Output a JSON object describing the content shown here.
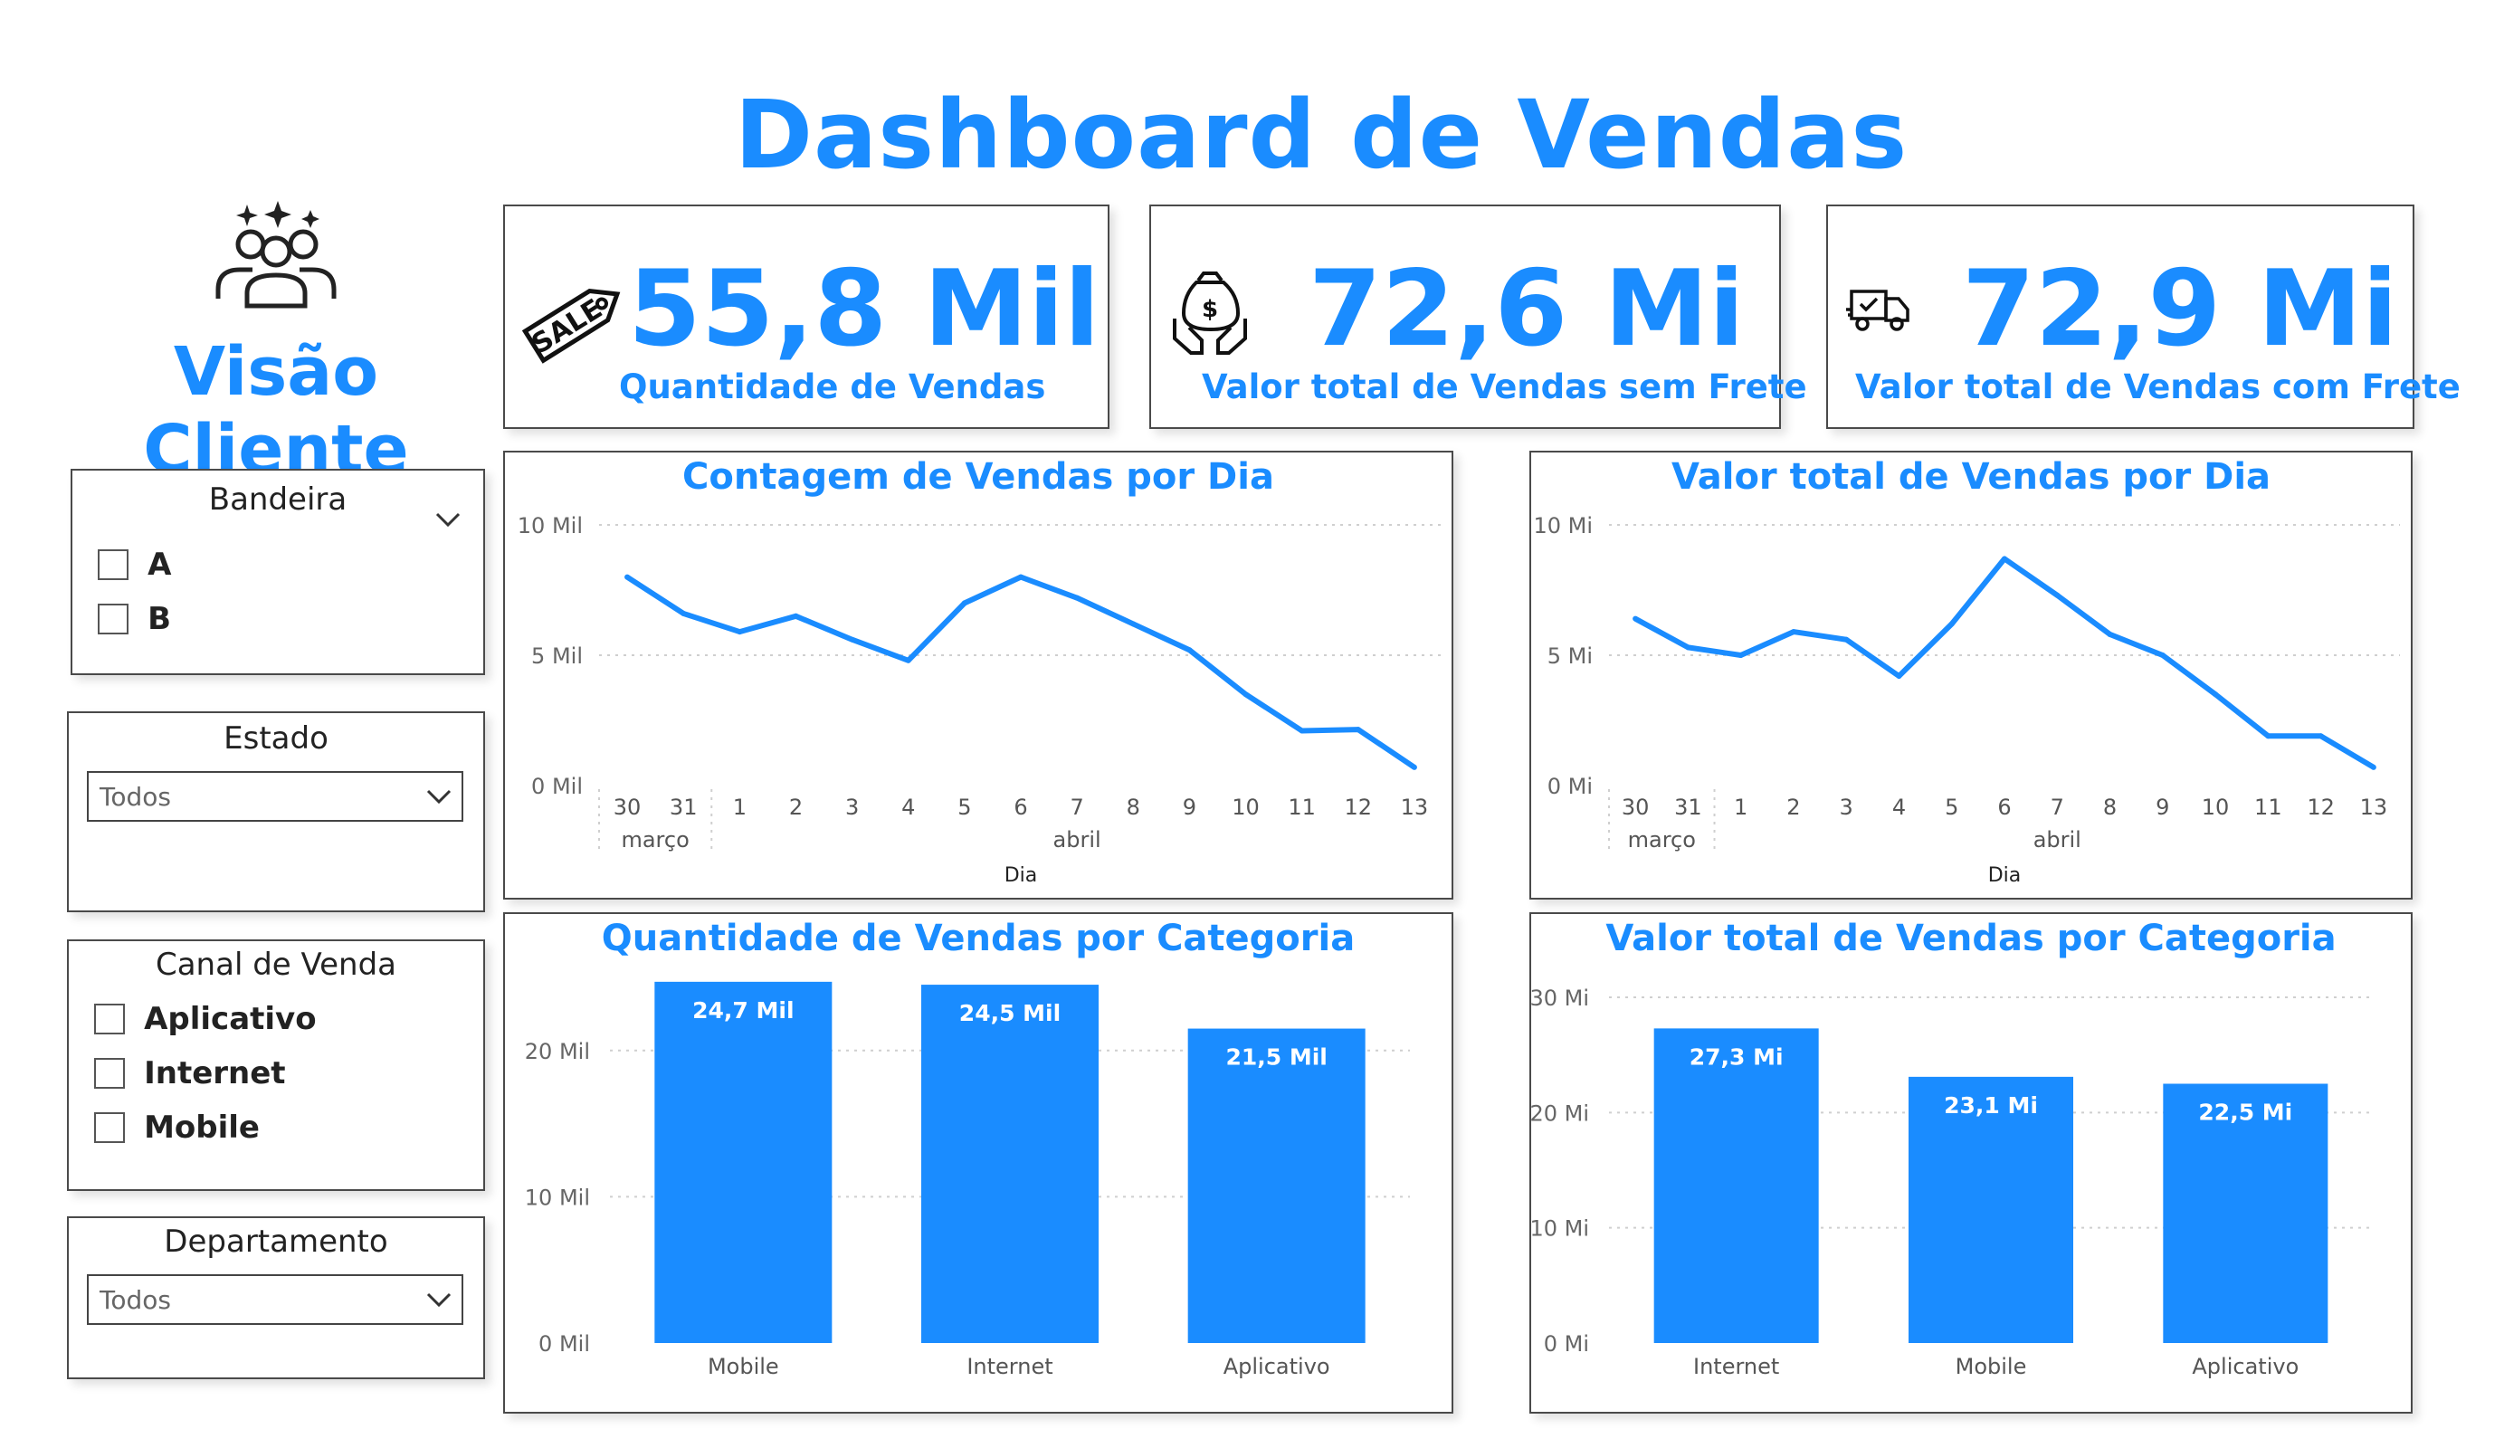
{
  "dashboard_title": "Dashboard de Vendas",
  "sidebar": {
    "heading": "Visão Cliente",
    "bandeira": {
      "title": "Bandeira",
      "options": [
        "A",
        "B"
      ]
    },
    "estado": {
      "title": "Estado",
      "selected": "Todos"
    },
    "canal": {
      "title": "Canal de Venda",
      "options": [
        "Aplicativo",
        "Internet",
        "Mobile"
      ]
    },
    "departamento": {
      "title": "Departamento",
      "selected": "Todos"
    }
  },
  "kpis": [
    {
      "value": "55,8 Mil",
      "label": "Quantidade de Vendas",
      "icon": "sale-tag-icon"
    },
    {
      "value": "72,6 Mi",
      "label": "Valor total de Vendas sem Frete",
      "icon": "money-hands-icon"
    },
    {
      "value": "72,9 Mi",
      "label": "Valor total de Vendas com Frete",
      "icon": "delivery-truck-icon"
    }
  ],
  "accent_color": "#1a8cff",
  "chart_data": [
    {
      "type": "line",
      "title": "Contagem de Vendas por Dia",
      "xlabel": "Dia",
      "x": [
        "30",
        "31",
        "1",
        "2",
        "3",
        "4",
        "5",
        "6",
        "7",
        "8",
        "9",
        "10",
        "11",
        "12",
        "13"
      ],
      "month_groups": [
        {
          "label": "março",
          "from": 0,
          "to": 1
        },
        {
          "label": "abril",
          "from": 2,
          "to": 14
        }
      ],
      "values": [
        8000,
        6600,
        5900,
        6500,
        5600,
        4800,
        7000,
        8000,
        7200,
        6200,
        5200,
        3500,
        2100,
        2150,
        700
      ],
      "ylim": [
        0,
        10000
      ],
      "yticks": [
        {
          "v": 0,
          "label": "0 Mil"
        },
        {
          "v": 5000,
          "label": "5 Mil"
        },
        {
          "v": 10000,
          "label": "10 Mil"
        }
      ]
    },
    {
      "type": "line",
      "title": "Valor total de Vendas por Dia",
      "xlabel": "Dia",
      "x": [
        "30",
        "31",
        "1",
        "2",
        "3",
        "4",
        "5",
        "6",
        "7",
        "8",
        "9",
        "10",
        "11",
        "12",
        "13"
      ],
      "month_groups": [
        {
          "label": "março",
          "from": 0,
          "to": 1
        },
        {
          "label": "abril",
          "from": 2,
          "to": 14
        }
      ],
      "values": [
        6400000,
        5300000,
        5000000,
        5900000,
        5600000,
        4200000,
        6200000,
        8700000,
        7300000,
        5800000,
        5000000,
        3500000,
        1900000,
        1900000,
        700000
      ],
      "ylim": [
        0,
        10000000
      ],
      "yticks": [
        {
          "v": 0,
          "label": "0 Mi"
        },
        {
          "v": 5000000,
          "label": "5 Mi"
        },
        {
          "v": 10000000,
          "label": "10 Mi"
        }
      ]
    },
    {
      "type": "bar",
      "title": "Quantidade de Vendas por Categoria",
      "categories": [
        "Mobile",
        "Internet",
        "Aplicativo"
      ],
      "values": [
        24700,
        24500,
        21500
      ],
      "data_labels": [
        "24,7 Mil",
        "24,5 Mil",
        "21,5 Mil"
      ],
      "ylim": [
        0,
        25000
      ],
      "yticks": [
        {
          "v": 0,
          "label": "0 Mil"
        },
        {
          "v": 10000,
          "label": "10 Mil"
        },
        {
          "v": 20000,
          "label": "20 Mil"
        }
      ]
    },
    {
      "type": "bar",
      "title": "Valor total de Vendas por Categoria",
      "categories": [
        "Internet",
        "Mobile",
        "Aplicativo"
      ],
      "values": [
        27300000,
        23100000,
        22500000
      ],
      "data_labels": [
        "27,3 Mi",
        "23,1 Mi",
        "22,5 Mi"
      ],
      "ylim": [
        0,
        30000000
      ],
      "yticks": [
        {
          "v": 0,
          "label": "0 Mi"
        },
        {
          "v": 10000000,
          "label": "10 Mi"
        },
        {
          "v": 20000000,
          "label": "20 Mi"
        },
        {
          "v": 30000000,
          "label": "30 Mi"
        }
      ]
    }
  ]
}
